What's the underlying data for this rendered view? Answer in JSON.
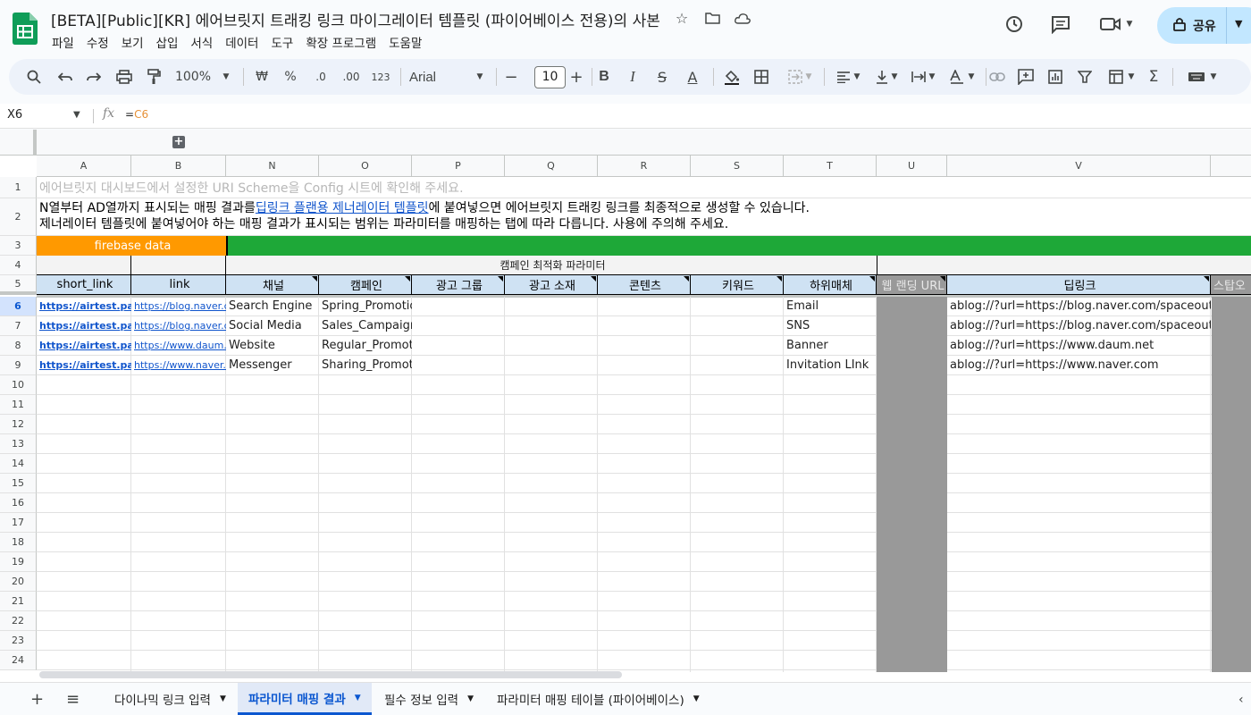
{
  "doc": {
    "title": "[BETA][Public][KR] 에어브릿지 트래킹 링크 마이그레이터 템플릿 (파이어베이스 전용)의 사본",
    "share_label": "공유"
  },
  "menu": [
    "파일",
    "수정",
    "보기",
    "삽입",
    "서식",
    "데이터",
    "도구",
    "확장 프로그램",
    "도움말"
  ],
  "toolbar": {
    "zoom": "100%",
    "currency": "₩",
    "percent": "%",
    "dec_decrease": ".0",
    "dec_increase": ".00",
    "number_format": "123",
    "font": "Arial",
    "font_size": "10"
  },
  "formula_bar": {
    "cell_ref": "X6",
    "formula_prefix": "=",
    "formula_ref": "C6"
  },
  "columns": [
    "A",
    "B",
    "N",
    "O",
    "P",
    "Q",
    "R",
    "S",
    "T",
    "U",
    "V"
  ],
  "row_numbers": [
    "1",
    "2",
    "3",
    "4",
    "5",
    "6",
    "7",
    "8",
    "9",
    "10",
    "11",
    "12",
    "13",
    "14",
    "15",
    "16",
    "17",
    "18",
    "19",
    "20",
    "21",
    "22",
    "23",
    "24"
  ],
  "sheet": {
    "row1": "에어브릿지 대시보드에서 설정한 URI Scheme을 Config 시트에 확인해 주세요.",
    "row2_line1_pre": "N열부터 AD열까지 표시되는 매핑 결과를 ",
    "row2_line1_link": "딥링크 플랜용 제너레이터 템플릿",
    "row2_line1_post": "에 붙여넣으면 에어브릿지 트래킹 링크를 최종적으로 생성할 수 있습니다.",
    "row2_line2": "제너레이터 템플릿에 붙여넣어야 하는 매핑 결과가 표시되는 범위는 파라미터를 매핑하는 탭에 따라 다릅니다. 사용에 주의해 주세요.",
    "firebase_label": "firebase data",
    "campaign_params_label": "캠페인 최적화 파라미터",
    "headers": [
      "short_link",
      "link",
      "채널",
      "캠페인",
      "광고 그룹",
      "광고 소재",
      "콘텐츠",
      "키워드",
      "하위매체",
      "웹 랜딩 URL",
      "딥링크",
      "스탑오"
    ],
    "rows": [
      {
        "short_link": "https://airtest.page.link",
        "link": "https://blog.naver.com/spaceoutgi",
        "channel": "Search Engine",
        "campaign": "Spring_Promotion",
        "sub": "Email",
        "deeplink": "ablog://?url=https://blog.naver.com/spaceoutgina"
      },
      {
        "short_link": "https://airtest.page.link",
        "link": "https://blog.naver.com/spaceoutgi",
        "channel": "Social Media",
        "campaign": "Sales_Campaign",
        "sub": "SNS",
        "deeplink": "ablog://?url=https://blog.naver.com/spaceoutgina"
      },
      {
        "short_link": "https://airtest.page.link",
        "link": "https://www.daum.net",
        "channel": "Website",
        "campaign": "Regular_Promotion",
        "sub": "Banner",
        "deeplink": "ablog://?url=https://www.daum.net"
      },
      {
        "short_link": "https://airtest.page.link",
        "link": "https://www.naver.com",
        "channel": "Messenger",
        "campaign": "Sharing_Promotion",
        "sub": "Invitation LInk",
        "deeplink": "ablog://?url=https://www.naver.com"
      }
    ]
  },
  "tabs": [
    {
      "label": "다이나믹 링크 입력",
      "active": false
    },
    {
      "label": "파라미터 매핑 결과",
      "active": true
    },
    {
      "label": "필수 정보 입력",
      "active": false
    },
    {
      "label": "파라미터 매핑 테이블 (파이어베이스)",
      "active": false
    }
  ],
  "colors": {
    "orange_header": "#ff9900",
    "green_header": "#1ea838",
    "blue_header": "#cfe2f3",
    "gray_column": "#999999",
    "accent": "#0b57d0"
  }
}
